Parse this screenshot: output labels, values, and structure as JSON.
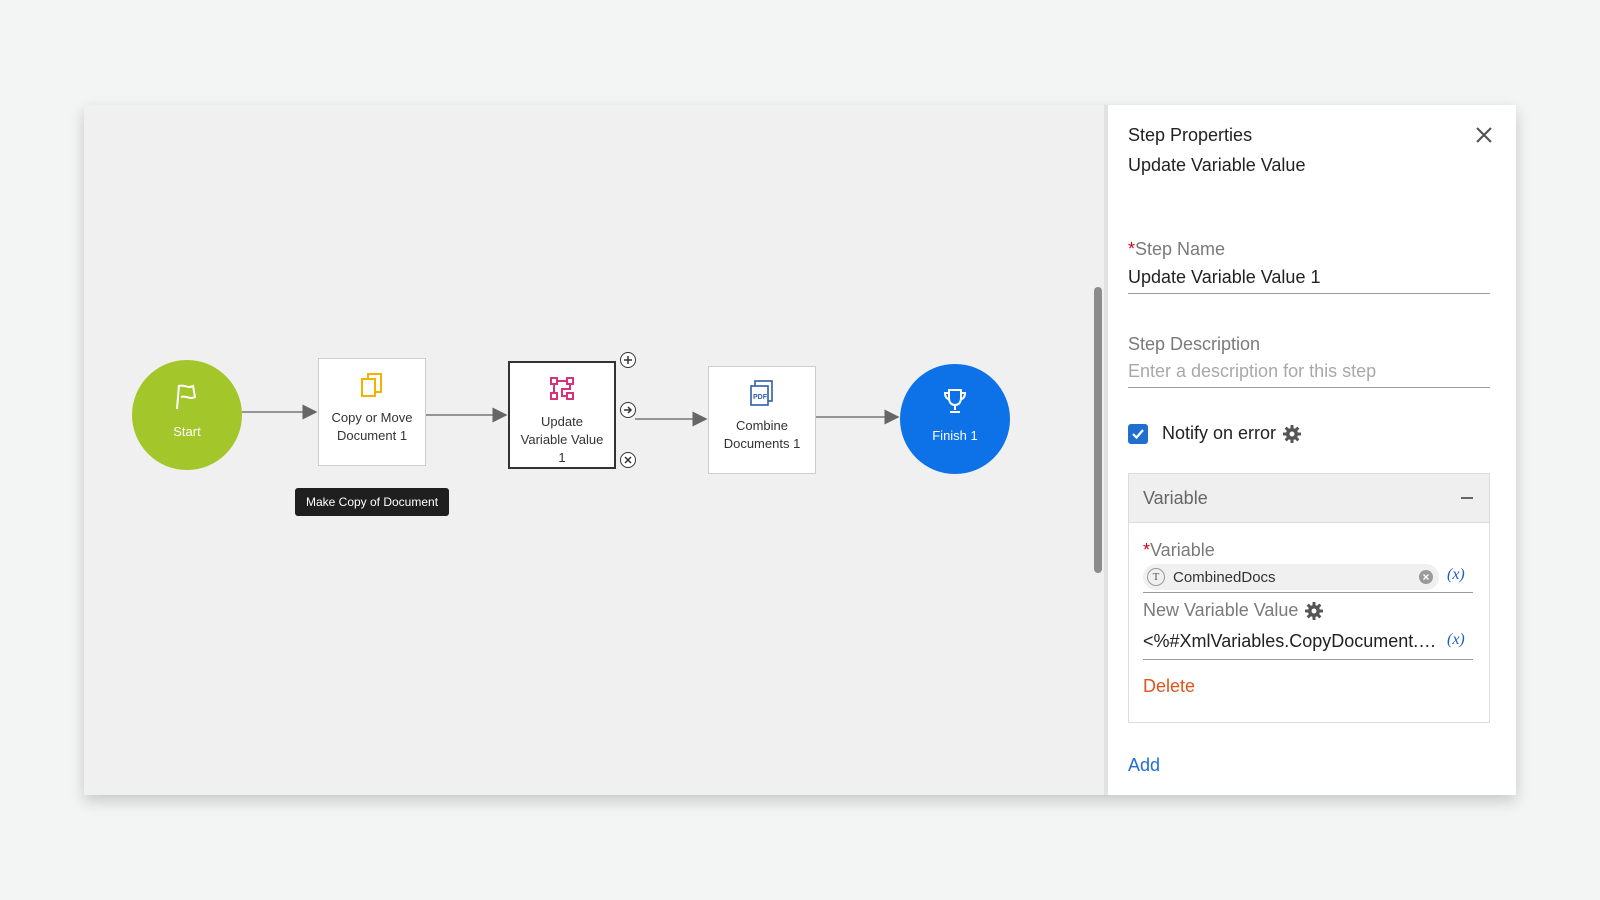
{
  "canvas": {
    "nodes": {
      "start": {
        "label": "Start",
        "color": "#a3c62b",
        "icon": "flag-icon"
      },
      "copy": {
        "label": "Copy or Move Document 1",
        "icon": "copy-document-icon"
      },
      "update": {
        "label": "Update Variable Value 1",
        "icon": "update-variable-icon"
      },
      "combine": {
        "label": "Combine Documents 1",
        "icon": "pdf-icon"
      },
      "finish": {
        "label": "Finish 1",
        "color": "#0d72e8",
        "icon": "trophy-icon"
      }
    },
    "tooltip": "Make Copy of Document"
  },
  "panel": {
    "title": "Step Properties",
    "subtitle": "Update Variable Value",
    "step_name": {
      "label": "Step Name",
      "value": "Update Variable Value 1"
    },
    "step_description": {
      "label": "Step Description",
      "placeholder": "Enter a description for this step"
    },
    "notify_on_error": {
      "label": "Notify on error",
      "checked": true
    },
    "variable_section": {
      "header": "Variable",
      "variable_label": "Variable",
      "variable_type": "T",
      "variable_value": "CombinedDocs",
      "fx_label": "(x)",
      "new_value_label": "New Variable Value",
      "new_value": "<%#XmlVariables.CopyDocument.Tree.Value%>",
      "delete_label": "Delete"
    },
    "add_label": "Add"
  },
  "colors": {
    "accent": "#1f6fd0",
    "delete": "#e0531c",
    "required": "#d0021b"
  }
}
